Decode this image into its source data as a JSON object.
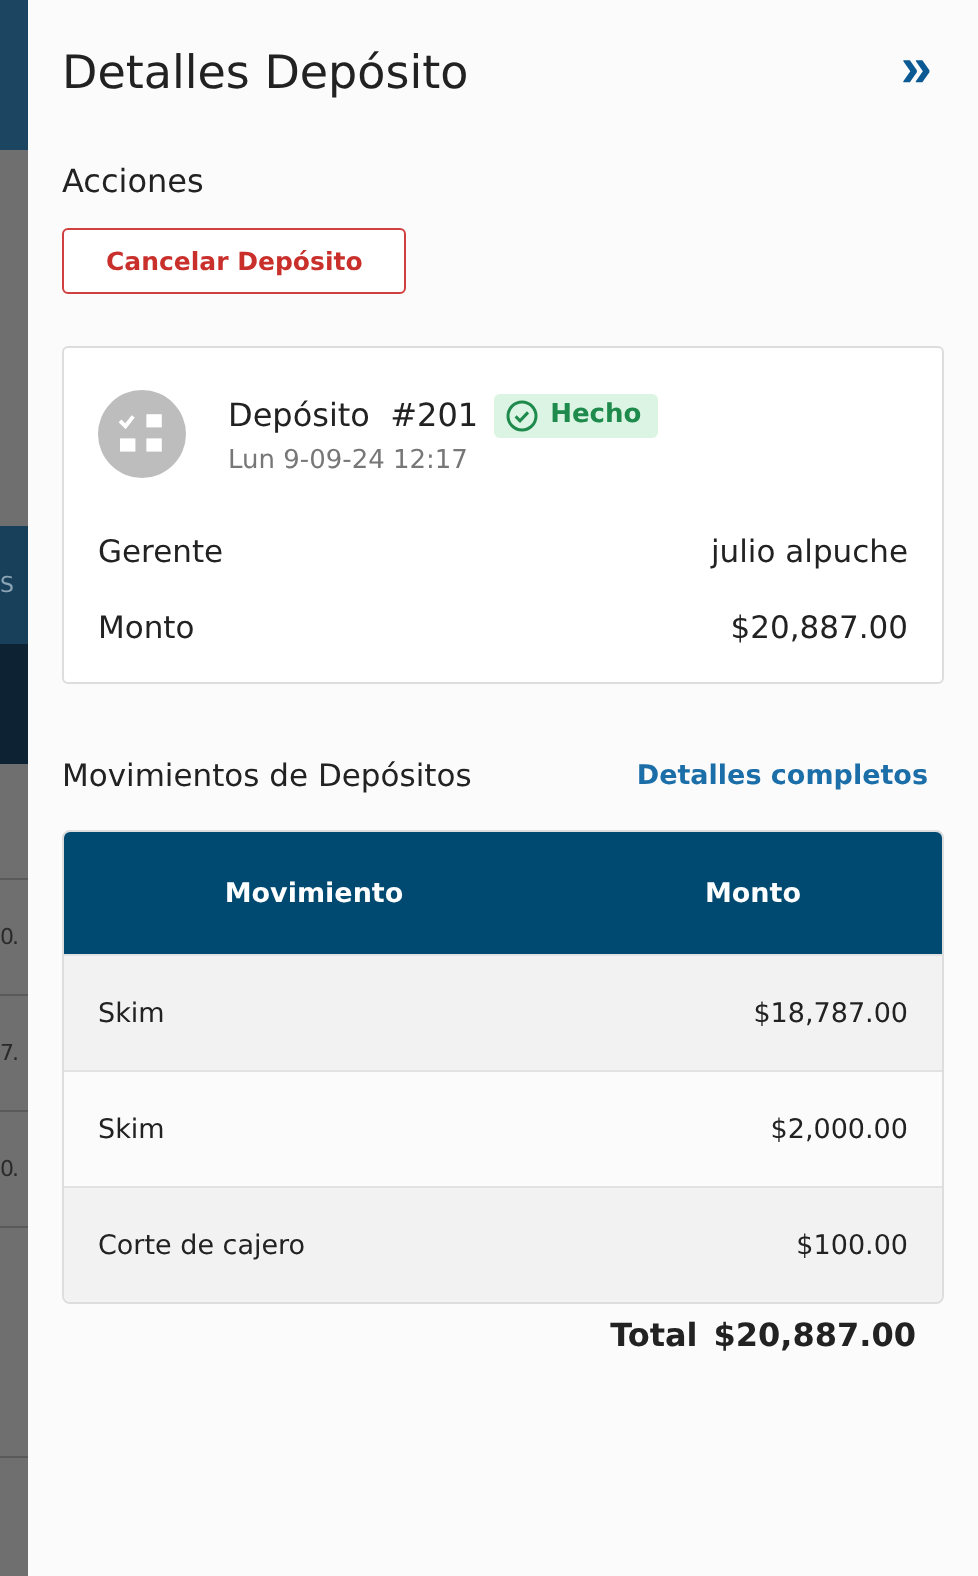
{
  "background_page": {
    "header_fragment": "S",
    "row_fragments": [
      "0.",
      "7.",
      "0."
    ]
  },
  "panel": {
    "title": "Detalles Depósito",
    "collapse_icon": "»"
  },
  "actions": {
    "label": "Acciones",
    "buttons": [
      "Cancelar Depósito"
    ]
  },
  "deposit": {
    "name": "Depósito  #201",
    "status": "Hecho",
    "date": "Lun 9-09-24 12:17",
    "fields": [
      {
        "label": "Gerente",
        "value": "julio alpuche"
      },
      {
        "label": "Monto",
        "value": "$20,887.00"
      }
    ]
  },
  "movements": {
    "title": "Movimientos de Depósitos",
    "link": "Detalles completos",
    "table": {
      "columns": [
        "Movimiento",
        "Monto"
      ],
      "rows": [
        [
          "Skim",
          "$18,787.00"
        ],
        [
          "Skim",
          "$2,000.00"
        ],
        [
          "Corte de cajero",
          "$100.00"
        ]
      ]
    },
    "total_label": "Total",
    "total_value": "$20,887.00"
  }
}
